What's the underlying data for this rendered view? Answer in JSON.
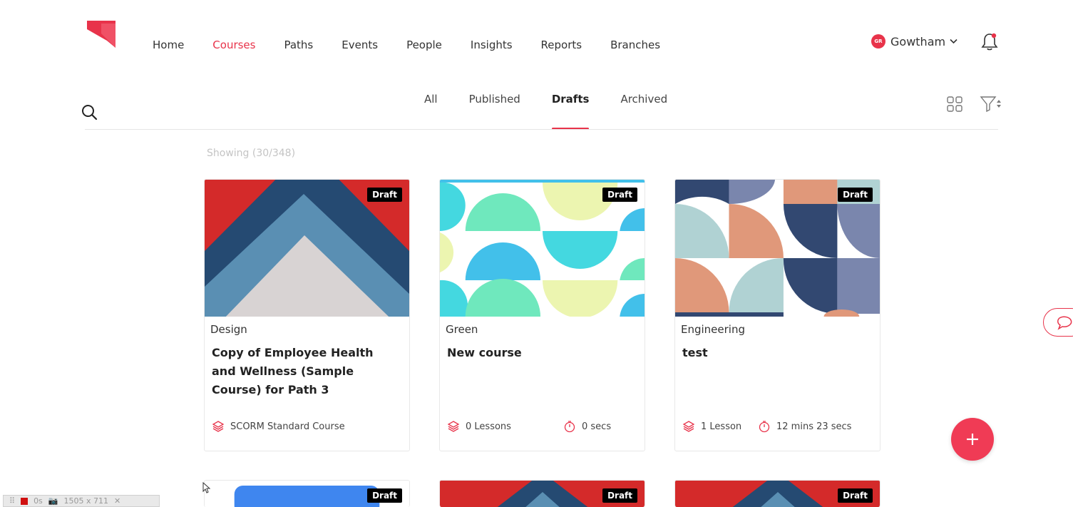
{
  "nav": {
    "items": [
      {
        "label": "Home",
        "active": false
      },
      {
        "label": "Courses",
        "active": true
      },
      {
        "label": "Paths",
        "active": false
      },
      {
        "label": "Events",
        "active": false
      },
      {
        "label": "People",
        "active": false
      },
      {
        "label": "Insights",
        "active": false
      },
      {
        "label": "Reports",
        "active": false
      },
      {
        "label": "Branches",
        "active": false
      }
    ]
  },
  "user": {
    "initials": "GR",
    "name": "Gowtham"
  },
  "tabs": [
    {
      "label": "All",
      "active": false
    },
    {
      "label": "Published",
      "active": false
    },
    {
      "label": "Drafts",
      "active": true
    },
    {
      "label": "Archived",
      "active": false
    }
  ],
  "showing": "Showing (30/348)",
  "badge_label": "Draft",
  "courses": [
    {
      "category": "Design",
      "title": "Copy of Employee Health and Wellness (Sample Course) for Path 3",
      "lessons": "SCORM Standard Course",
      "duration": ""
    },
    {
      "category": "Green",
      "title": "New course",
      "lessons": "0 Lessons",
      "duration": "0 secs"
    },
    {
      "category": "Engineering",
      "title": "test",
      "lessons": "1 Lesson",
      "duration": "12 mins 23 secs"
    }
  ],
  "devbar": {
    "time": "0s",
    "size": "1505 x 711"
  },
  "colors": {
    "accent": "#e8334a",
    "fab": "#f03b55"
  }
}
